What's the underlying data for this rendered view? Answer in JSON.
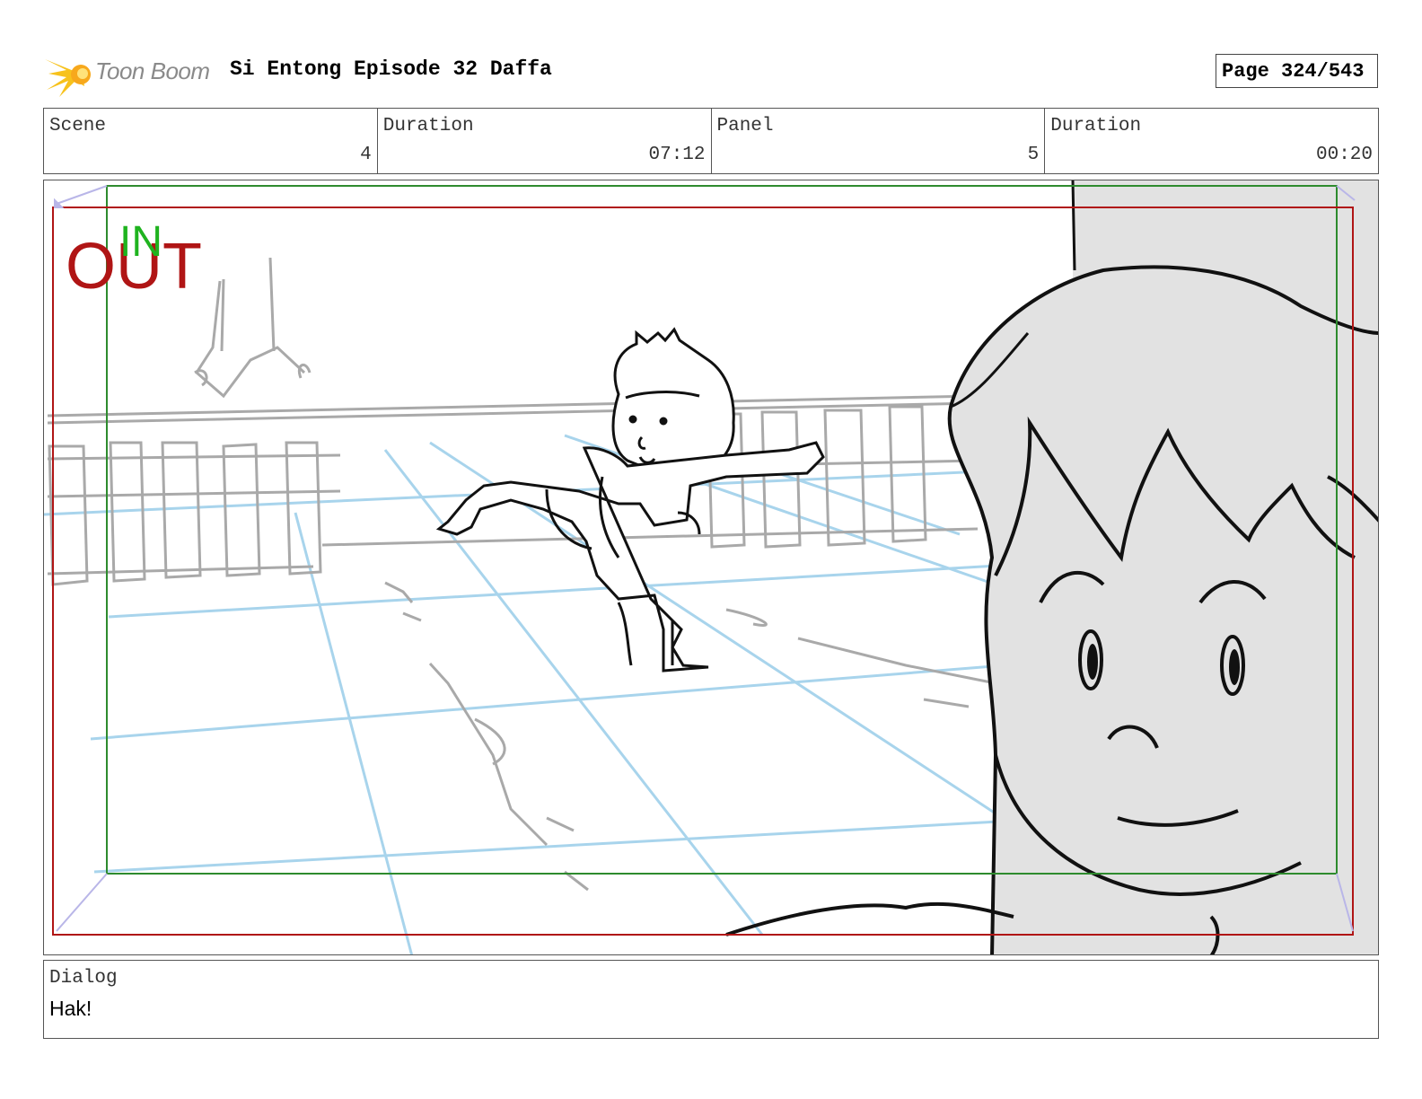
{
  "header": {
    "logo_text": "Toon Boom",
    "project_title": "Si Entong Episode 32 Daffa",
    "page_indicator": "Page 324/543"
  },
  "info": {
    "scene_label": "Scene",
    "scene_value": "4",
    "scene_duration_label": "Duration",
    "scene_duration_value": "07:12",
    "panel_label": "Panel",
    "panel_value": "5",
    "panel_duration_label": "Duration",
    "panel_duration_value": "00:20"
  },
  "panel": {
    "in_marker": "IN",
    "out_marker": "OUT",
    "colors": {
      "in_frame": "#2e8b2e",
      "out_frame": "#b01515",
      "guide": "#a8d4ec",
      "sketch": "#111111",
      "background_sketch": "#a9a9a9",
      "fill_gray": "#e2e2e2"
    }
  },
  "dialog": {
    "label": "Dialog",
    "text": "Hak!"
  }
}
